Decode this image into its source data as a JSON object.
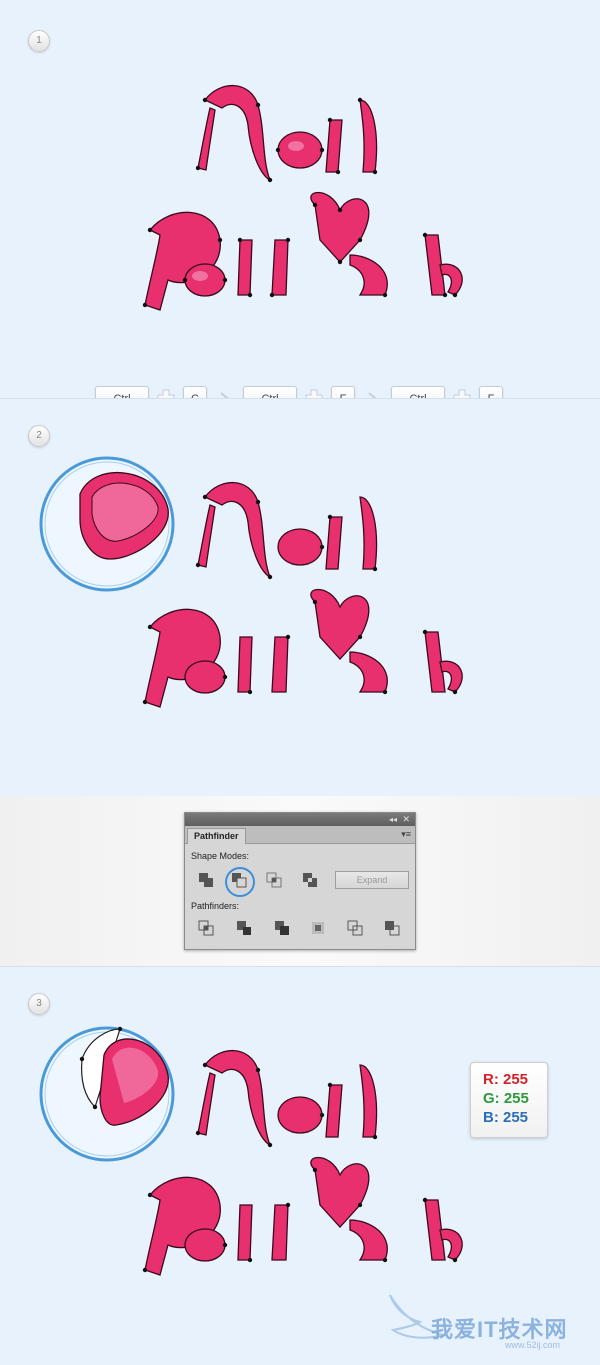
{
  "steps": [
    "1",
    "2",
    "3"
  ],
  "artwork": {
    "line1": "Nail",
    "line2": "Polish"
  },
  "shortcuts": [
    {
      "key": "Ctrl"
    },
    {
      "key": "C"
    },
    {
      "key": "Ctrl"
    },
    {
      "key": "F"
    },
    {
      "key": "Ctrl"
    },
    {
      "key": "F"
    }
  ],
  "pathfinder": {
    "tab": "Pathfinder",
    "shape_modes_label": "Shape Modes:",
    "pathfinders_label": "Pathfinders:",
    "expand_label": "Expand",
    "collapse_glyph": "◂◂",
    "close_glyph": "✕",
    "menu_glyph": "▾≡"
  },
  "fill_color": {
    "r_label": "R: 255",
    "g_label": "G: 255",
    "b_label": "B: 255",
    "value": "#ffffff"
  },
  "colors": {
    "pink": "#e8306e",
    "pink_light": "#f0679a",
    "bg": "#e8f2fd",
    "highlight": "#3a8fd8"
  },
  "watermark": {
    "text": "我爱IT技术网",
    "url": "www.52ij.com"
  }
}
